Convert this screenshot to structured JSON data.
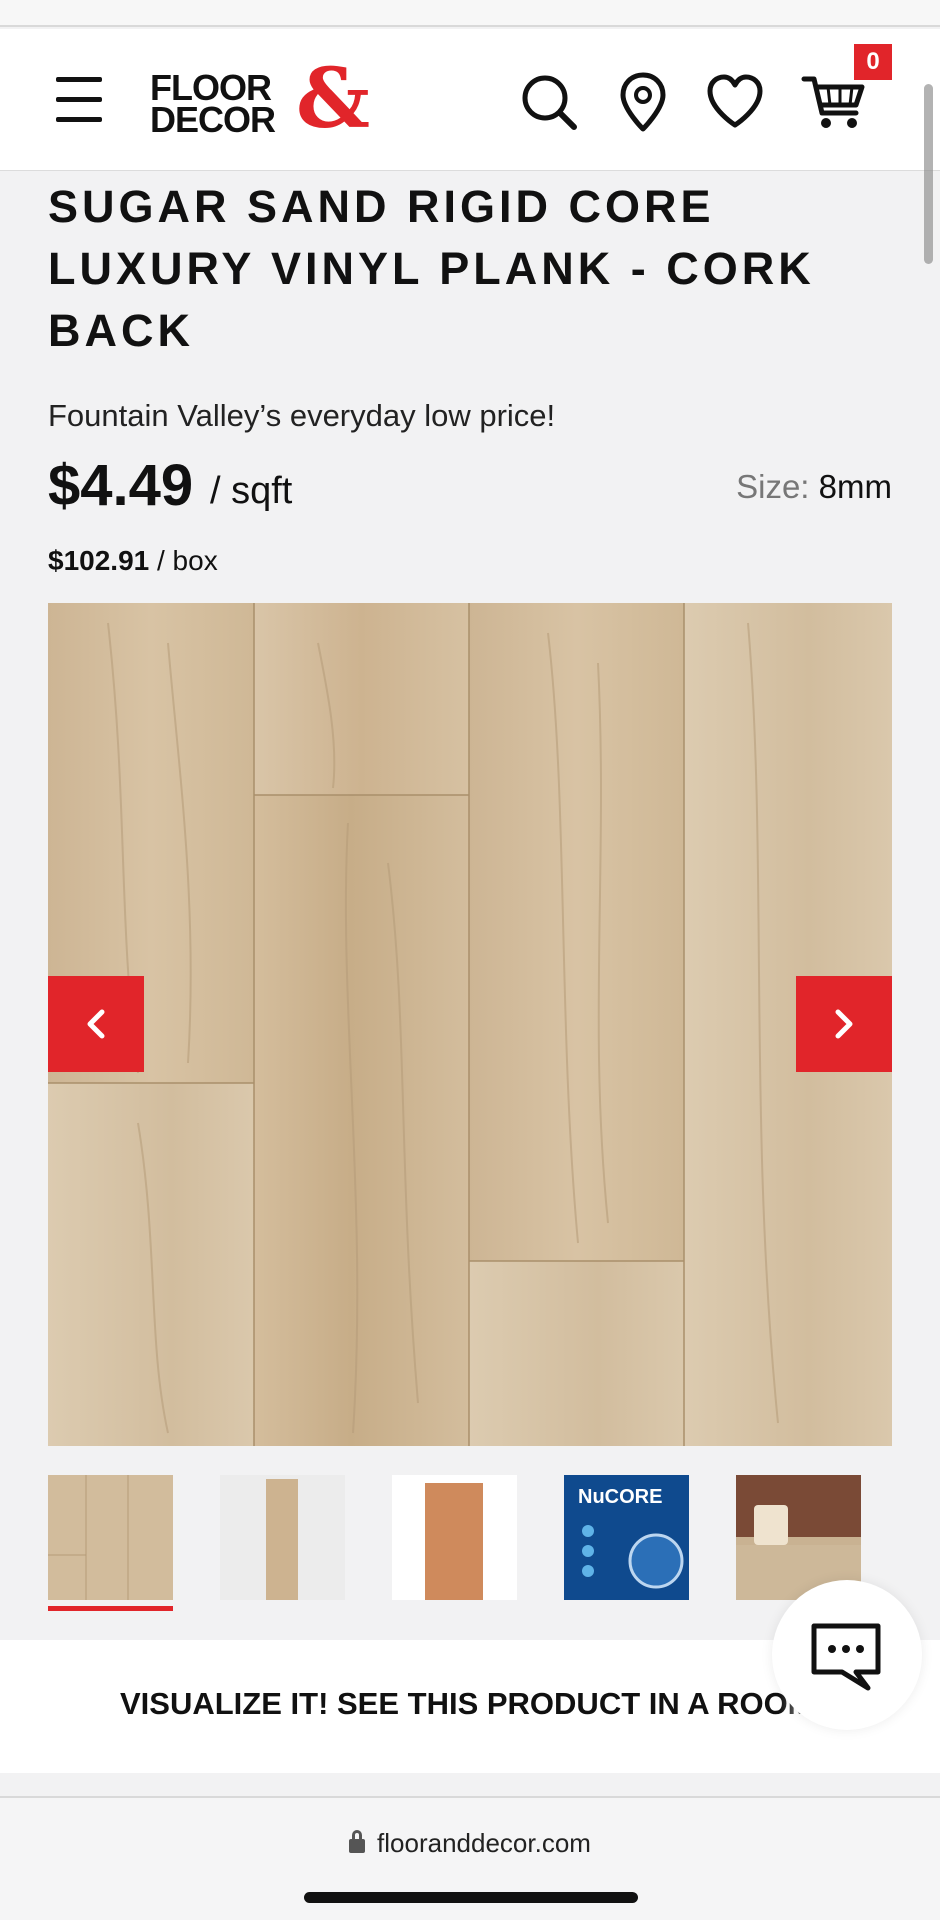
{
  "header": {
    "logo_line1": "FLOOR",
    "logo_line2": "DECOR",
    "logo_amp": "&",
    "cart_count": "0"
  },
  "icons": {
    "menu": "hamburger-menu-icon",
    "search": "search-icon",
    "location": "location-pin-icon",
    "wishlist": "heart-icon",
    "cart": "cart-icon",
    "prev": "chevron-left-icon",
    "next": "chevron-right-icon",
    "chat": "chat-icon",
    "lock": "lock-icon"
  },
  "product": {
    "title": "SUGAR SAND RIGID CORE LUXURY VINYL PLANK - CORK BACK",
    "store_price_line": "Fountain Valley’s everyday low price!",
    "price": "$4.49",
    "price_unit": "/ sqft",
    "size_label": "Size:",
    "size_value": "8mm",
    "box_price": "$102.91",
    "box_unit": "/ box"
  },
  "thumbnails": {
    "selected_index": 0,
    "nucore_label": "NuCORE"
  },
  "visualize": {
    "label": "VISUALIZE IT! SEE THIS PRODUCT IN A ROOM"
  },
  "browser": {
    "url": "flooranddecor.com"
  },
  "colors": {
    "brand_red": "#e1252a",
    "wood_base": "#d2bc9c"
  }
}
